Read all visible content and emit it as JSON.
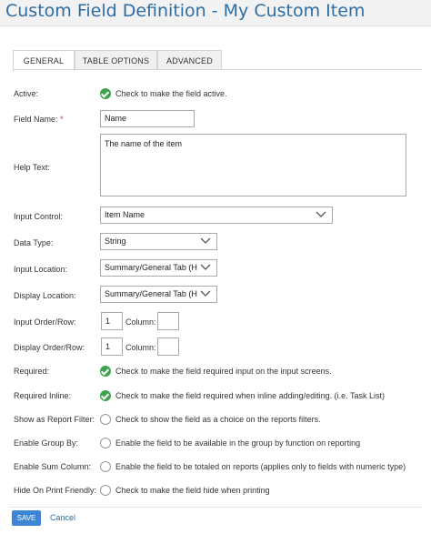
{
  "page": {
    "title": "Custom Field Definition - My Custom Item"
  },
  "tabs": [
    {
      "label": "GENERAL",
      "active": true
    },
    {
      "label": "TABLE OPTIONS",
      "active": false
    },
    {
      "label": "ADVANCED",
      "active": false
    }
  ],
  "form": {
    "active": {
      "label": "Active:",
      "text": "Check to make the field active.",
      "checked": true
    },
    "field_name": {
      "label": "Field Name:",
      "required_mark": "*",
      "value": "Name"
    },
    "help_text": {
      "label": "Help Text:",
      "value": "The name of the item"
    },
    "input_control": {
      "label": "Input Control:",
      "value": "Item Name"
    },
    "data_type": {
      "label": "Data Type:",
      "value": "String"
    },
    "input_location": {
      "label": "Input Location:",
      "value": "Summary/General Tab (H"
    },
    "display_location": {
      "label": "Display Location:",
      "value": "Summary/General Tab (H"
    },
    "input_order": {
      "label": "Input Order/Row:",
      "value": "1",
      "column_label": "Column:",
      "column_value": ""
    },
    "display_order": {
      "label": "Display Order/Row:",
      "value": "1",
      "column_label": "Column:",
      "column_value": ""
    },
    "required": {
      "label": "Required:",
      "text": "Check to make the field required input on the input screens.",
      "checked": true
    },
    "required_inline": {
      "label": "Required Inline:",
      "text": "Check to make the field required when inline adding/editing. (i.e. Task List)",
      "checked": true
    },
    "report_filter": {
      "label": "Show as Report Filter:",
      "text": "Check to show the field as a choice on the reports filters.",
      "checked": false
    },
    "group_by": {
      "label": "Enable Group By:",
      "text": "Enable the field to be available in the group by function on reporting",
      "checked": false
    },
    "sum_column": {
      "label": "Enable Sum Column:",
      "text": "Enable the field to be totaled on reports (applies only to fields with numeric type)",
      "checked": false
    },
    "hide_print": {
      "label": "Hide On Print Friendly:",
      "text": "Check to make the field hide when printing",
      "checked": false
    }
  },
  "footer": {
    "save_label": "SAVE",
    "cancel_label": "Cancel"
  },
  "colors": {
    "accent": "#2e6da4",
    "check_green": "#3fa34d",
    "save_bg": "#3d86d6"
  }
}
